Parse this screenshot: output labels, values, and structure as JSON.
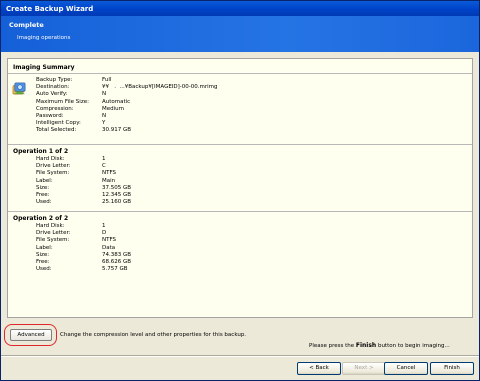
{
  "window": {
    "title": "Create Backup Wizard"
  },
  "banner": {
    "title": "Complete",
    "subtitle": "Imaging operations"
  },
  "summary": {
    "header": "Imaging Summary",
    "rows": [
      {
        "k": "Backup Type:",
        "v": "Full"
      },
      {
        "k": "Destination:",
        "v": "¥¥   .  ...¥Backup¥[IMAGEID]-00-00.mrimg"
      },
      {
        "k": "Auto Verify:",
        "v": "N"
      },
      {
        "k": "Maximum File Size:",
        "v": "Automatic"
      },
      {
        "k": "Compression:",
        "v": "Medium"
      },
      {
        "k": "Password:",
        "v": "N"
      },
      {
        "k": "Intelligent Copy:",
        "v": "Y"
      },
      {
        "k": "Total Selected:",
        "v": "30.917 GB"
      }
    ]
  },
  "op1": {
    "header": "Operation 1 of 2",
    "rows": [
      {
        "k": "Hard Disk:",
        "v": "1"
      },
      {
        "k": "Drive Letter:",
        "v": "C"
      },
      {
        "k": "File System:",
        "v": "NTFS"
      },
      {
        "k": "Label:",
        "v": "Main"
      },
      {
        "k": "Size:",
        "v": "37.505 GB"
      },
      {
        "k": "Free:",
        "v": "12.345 GB"
      },
      {
        "k": "Used:",
        "v": "25.160 GB"
      }
    ]
  },
  "op2": {
    "header": "Operation 2 of 2",
    "rows": [
      {
        "k": "Hard Disk:",
        "v": "1"
      },
      {
        "k": "Drive Letter:",
        "v": "D"
      },
      {
        "k": "File System:",
        "v": "NTFS"
      },
      {
        "k": "Label:",
        "v": "Data"
      },
      {
        "k": "Size:",
        "v": "74.383 GB"
      },
      {
        "k": "Free:",
        "v": "68.626 GB"
      },
      {
        "k": "Used:",
        "v": "5.757 GB"
      }
    ]
  },
  "advanced": {
    "label": "Advanced",
    "description": "Change the compression level and other properties for this backup."
  },
  "finish_hint": {
    "before": "Please press the ",
    "bold": "Finish",
    "after": " button to begin imaging..."
  },
  "buttons": {
    "back": "< Back",
    "next": "Next >",
    "cancel": "Cancel",
    "finish": "Finish"
  },
  "icons": {
    "backup": "backup-icon"
  },
  "colors": {
    "title_bar": "#0043c8",
    "banner": "#2574e4",
    "content_bg": "#fffff0",
    "highlight_ring": "#e0282c"
  }
}
